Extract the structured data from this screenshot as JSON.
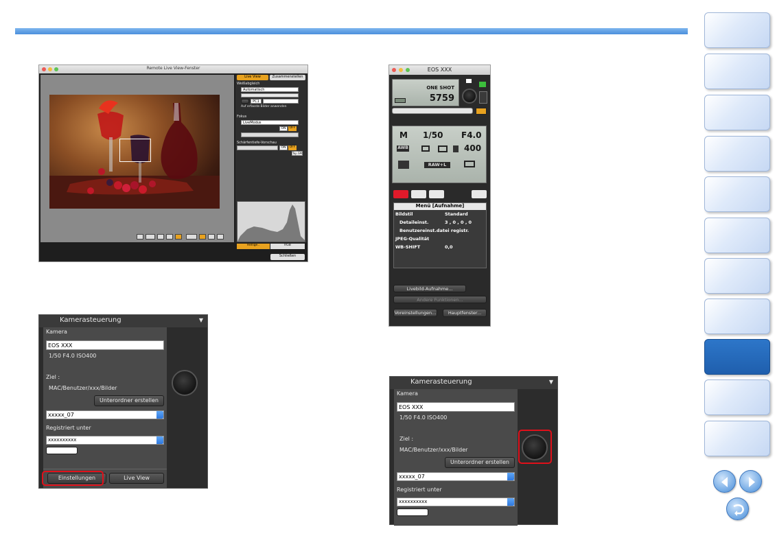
{
  "remote_live_view": {
    "title": "Remote Live View-Fenster",
    "tab_live_view": "Live View",
    "tab_zusammenstellen": "Zusammenstellen",
    "wb_label": "Weißabgleich",
    "wb_value": "Automatisch",
    "apply_checkbox": "Auf erfasste Bilder anwenden",
    "pc_button": "PC1",
    "focus_label": "Fokus",
    "focus_value": "LiveModus",
    "on": "ON",
    "off": "OFF",
    "dof_label": "Schärfentiefe-Vorschau",
    "top_button": "Top.SM",
    "histogram_tab_brightness": "Hellige..",
    "histogram_tab_rgb": "RGB",
    "close_button": "Schließen"
  },
  "main_window": {
    "title": "EOS  XXX",
    "lcd_mode": "ONE SHOT",
    "lcd_shots": "5759",
    "shutter_speed": "1/50",
    "aperture": "F4.0",
    "mode": "M",
    "iso": "400",
    "awb": "AWB",
    "raw_l": "RAW+L",
    "menu_title": "Menü [Aufnahme]",
    "menu_rows": [
      {
        "label": "Bildstil",
        "value": "Standard"
      },
      {
        "label": "Detaileinst.",
        "value": "3 , 0 , 0 , 0"
      },
      {
        "label": "Benutzereinst.datei registr.",
        "value": ""
      },
      {
        "label": "JPEG-Qualität",
        "value": ""
      },
      {
        "label": "WB-SHIFT",
        "value": "0,0"
      }
    ],
    "liveview_button": "Livebild-Aufnahme...",
    "other_functions": "Andere Funktionen...",
    "preferences_button": "Voreinstellungen...",
    "main_window_button": "Hauptfenster..."
  },
  "camera_control_1": {
    "title": "Kamerasteuerung",
    "camera_label": "Kamera",
    "camera_value": "EOS XXX",
    "exposure": "1/50  F4.0  ISO400",
    "target_label": "Ziel :",
    "target_path": "MAC/Benutzer/xxx/Bilder",
    "subfolder_button": "Unterordner erstellen",
    "folder_value": "xxxxx_07",
    "registered_label": "Registriert unter",
    "registered_value": "xxxxxxxxxx",
    "settings_button": "Einstellungen",
    "live_view_button": "Live View"
  },
  "camera_control_2": {
    "title": "Kamerasteuerung",
    "camera_label": "Kamera",
    "camera_value": "EOS XXX",
    "exposure": "1/50  F4.0  ISO400",
    "target_label": "Ziel :",
    "target_path": "MAC/Benutzer/xxx/Bilder",
    "subfolder_button": "Unterordner erstellen",
    "folder_value": "xxxxx_07",
    "registered_label": "Registriert unter",
    "registered_value": "xxxxxxxxxx"
  },
  "colors": {
    "accent_blue": "#2d76c9",
    "highlight_red": "#e1101a",
    "orange_tab": "#e8a21f"
  }
}
